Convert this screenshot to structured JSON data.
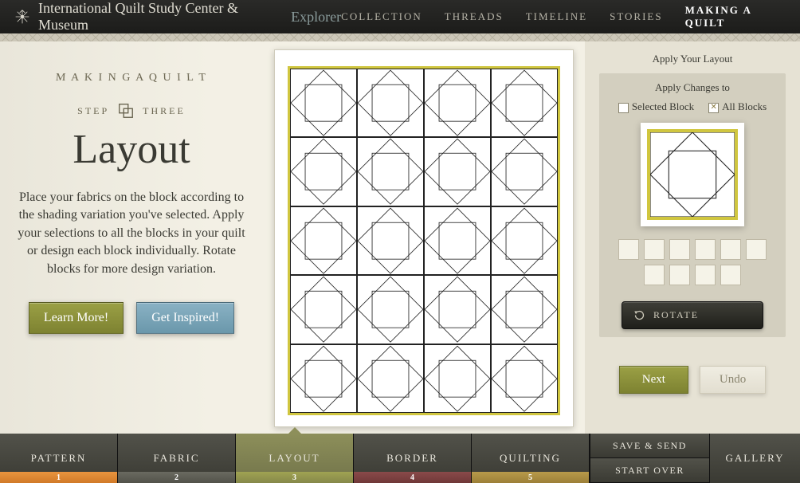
{
  "header": {
    "title": "International Quilt Study Center & Museum",
    "explorer": "Explorer",
    "nav": [
      "COLLECTION",
      "THREADS",
      "TIMELINE",
      "STORIES",
      "MAKING A QUILT"
    ],
    "activeNav": 4
  },
  "left": {
    "kicker": "M A K I N G   A   Q U I L T",
    "stepWord": "STEP",
    "stepNum": "THREE",
    "title": "Layout",
    "desc": "Place your fabrics on the block according to the shading variation you've selected. Apply your selections to all the blocks in your quilt or design each block individually. Rotate blocks for more design variation.",
    "learnMore": "Learn More!",
    "getInspired": "Get Inspired!"
  },
  "right": {
    "applyTitle": "Apply Your Layout",
    "applyChanges": "Apply Changes to",
    "selectedBlock": "Selected Block",
    "allBlocks": "All Blocks",
    "rotate": "ROTATE",
    "next": "Next",
    "undo": "Undo"
  },
  "footer": {
    "tabs": [
      {
        "label": "PATTERN",
        "num": "1",
        "bar": "bar-orange"
      },
      {
        "label": "FABRIC",
        "num": "2",
        "bar": "bar-grey"
      },
      {
        "label": "LAYOUT",
        "num": "3",
        "bar": "bar-olive"
      },
      {
        "label": "BORDER",
        "num": "4",
        "bar": "bar-maroon"
      },
      {
        "label": "QUILTING",
        "num": "5",
        "bar": "bar-gold"
      }
    ],
    "activeTab": 2,
    "saveSend": "SAVE & SEND",
    "startOver": "START OVER",
    "gallery": "GALLERY"
  }
}
